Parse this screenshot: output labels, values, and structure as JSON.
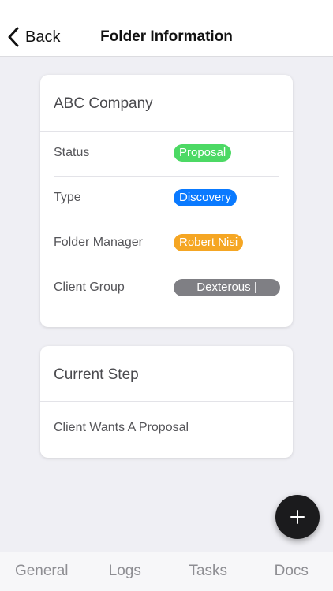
{
  "header": {
    "back_label": "Back",
    "title": "Folder Information"
  },
  "info_card": {
    "title": "ABC Company",
    "rows": [
      {
        "label": "Status",
        "value": "Proposal",
        "color": "#4cd964"
      },
      {
        "label": "Type",
        "value": "Discovery",
        "color": "#0a7aff"
      },
      {
        "label": "Folder Manager",
        "value": "Robert Nisi",
        "color": "#f5a623"
      },
      {
        "label": "Client Group",
        "value": "Dexterous |",
        "color": "#7f7f84"
      }
    ]
  },
  "step_card": {
    "title": "Current Step",
    "text": "Client Wants A Proposal"
  },
  "fab": {
    "icon": "plus-icon"
  },
  "tabs": [
    {
      "label": "General"
    },
    {
      "label": "Logs"
    },
    {
      "label": "Tasks"
    },
    {
      "label": "Docs"
    }
  ],
  "colors": {
    "background": "#efeff4",
    "fab": "#1b1b1d",
    "tab_inactive": "#8e8e93"
  }
}
